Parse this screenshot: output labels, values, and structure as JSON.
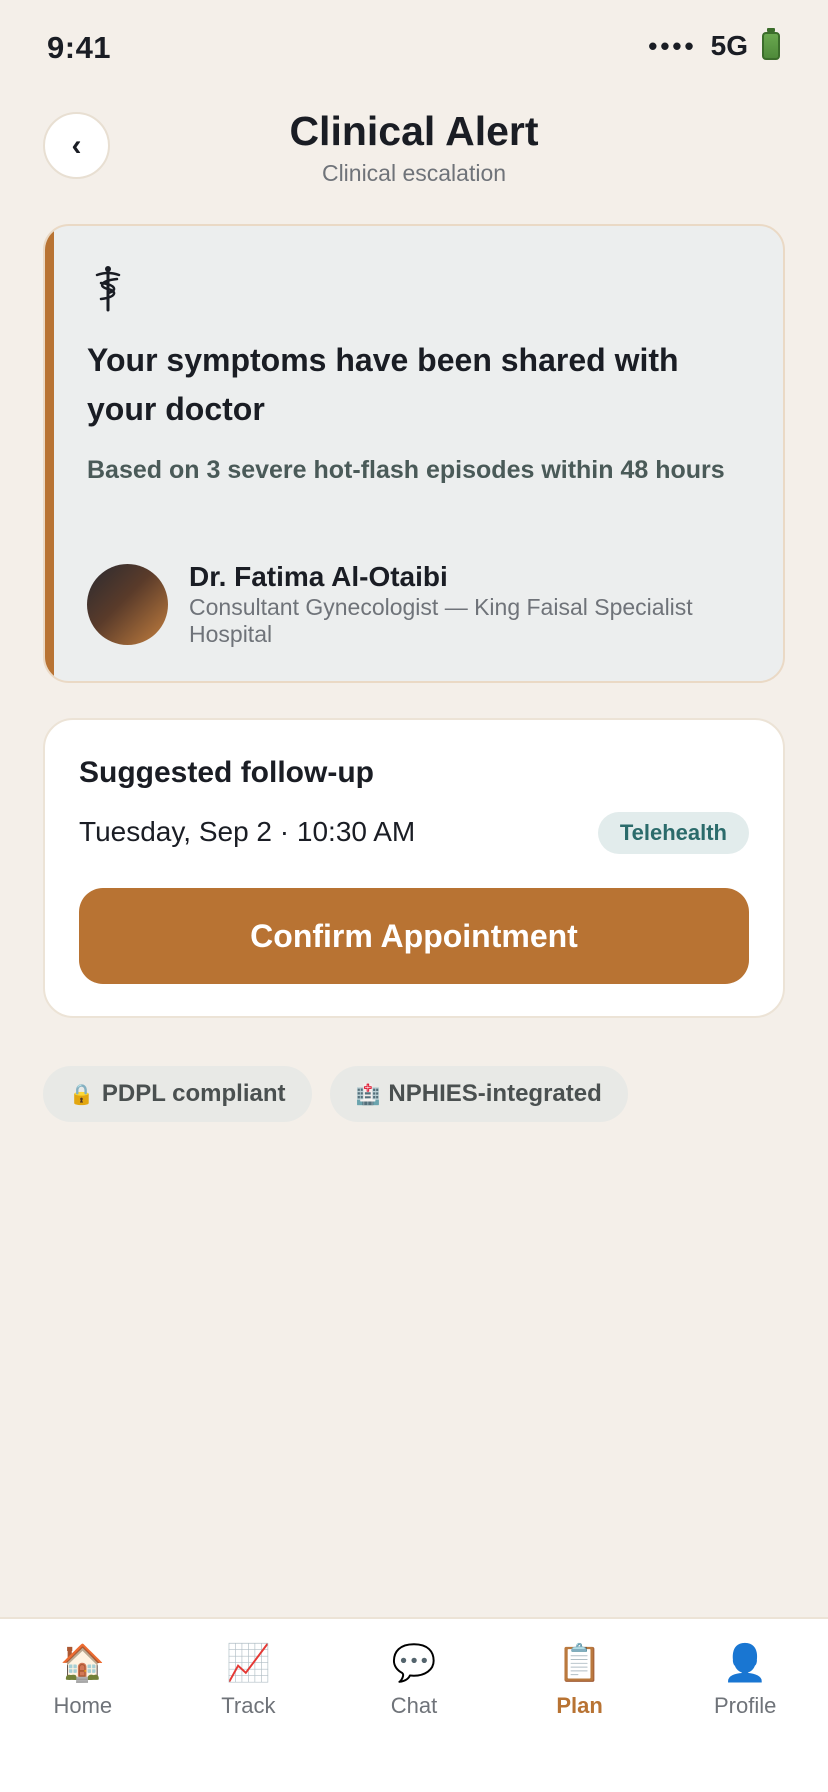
{
  "status_bar": {
    "time": "9:41",
    "signal": "••••",
    "network": "5G",
    "battery_icon": "battery-icon"
  },
  "header": {
    "back_icon": "‹",
    "title": "Clinical Alert",
    "subtitle": "Clinical escalation"
  },
  "alert": {
    "icon": "caduceus-icon",
    "title": "Your symptoms have been shared with your doctor",
    "description": "Based on 3 severe hot-flash episodes within 48 hours",
    "doctor": {
      "name": "Dr. Fatima Al-Otaibi",
      "role": "Consultant Gynecologist — King Faisal Specialist Hospital"
    },
    "accent_color": "#b87333"
  },
  "followup": {
    "title": "Suggested follow-up",
    "datetime": "Tuesday, Sep 2 · 10:30 AM",
    "badge": "Telehealth",
    "confirm_label": "Confirm Appointment"
  },
  "chips": [
    {
      "icon": "🔒",
      "label": "PDPL compliant"
    },
    {
      "icon": "🏥",
      "label": "NPHIES-integrated"
    }
  ],
  "tabs": [
    {
      "icon": "🏠",
      "label": "Home",
      "active": false
    },
    {
      "icon": "📈",
      "label": "Track",
      "active": false
    },
    {
      "icon": "💬",
      "label": "Chat",
      "active": false
    },
    {
      "icon": "📋",
      "label": "Plan",
      "active": true
    },
    {
      "icon": "👤",
      "label": "Profile",
      "active": false
    }
  ],
  "colors": {
    "accent": "#b87333",
    "background": "#f4efe9",
    "teal": "#2b6b6b"
  }
}
